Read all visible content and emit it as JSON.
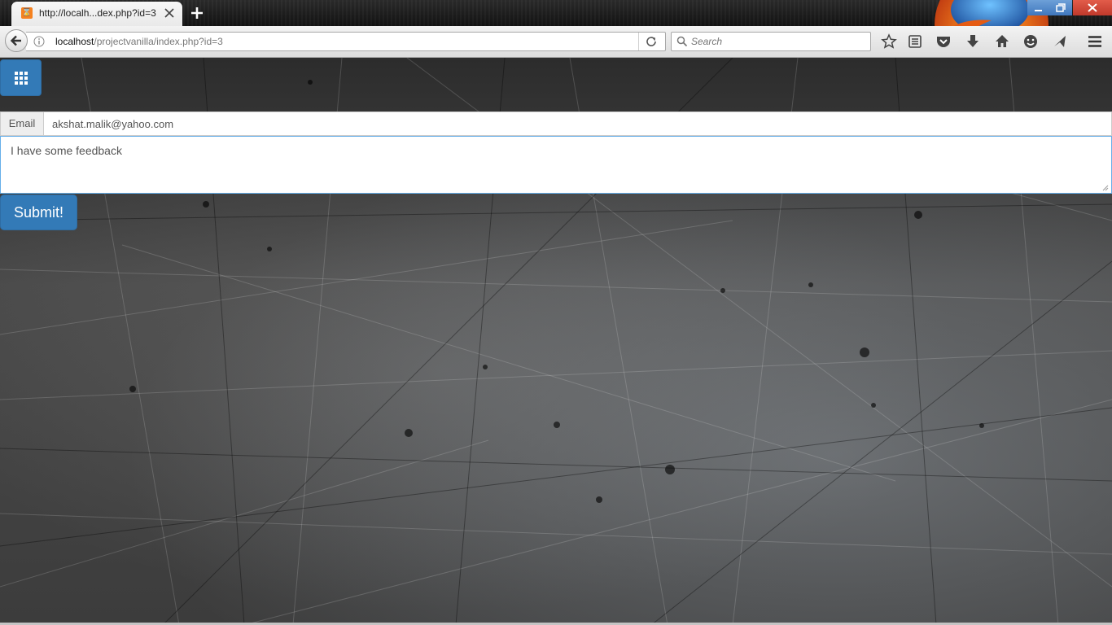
{
  "browser": {
    "tab_title": "http://localh...dex.php?id=3",
    "tab_favicon_icon": "xampp-icon",
    "url_host": "localhost",
    "url_path": "/projectvanilla/index.php?id=3",
    "search_placeholder": "Search",
    "toolbar_icons": [
      "bookmark-star-icon",
      "reading-list-icon",
      "pocket-icon",
      "download-icon",
      "home-icon",
      "hello-icon",
      "share-icon",
      "hamburger-menu-icon"
    ]
  },
  "page": {
    "menu_icon": "grid-icon",
    "email_label": "Email",
    "email_value": "akshat.malik@yahoo.com",
    "feedback_value": "I have some feedback",
    "submit_label": "Submit!"
  },
  "colors": {
    "primary_button": "#337ab7",
    "focus_border": "#66afe9"
  }
}
